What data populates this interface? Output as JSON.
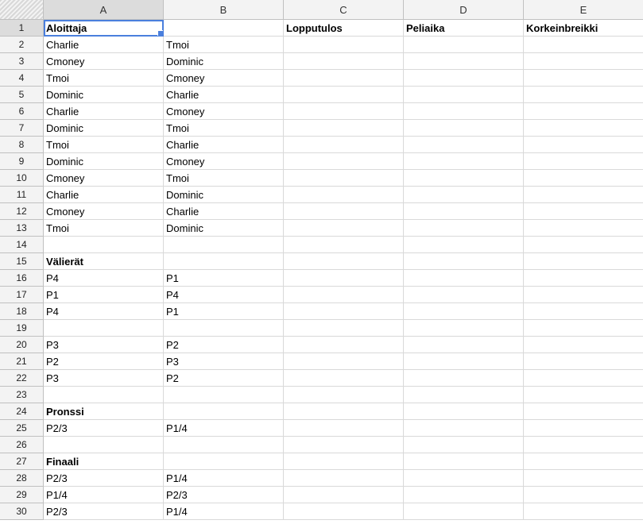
{
  "columns": [
    "A",
    "B",
    "C",
    "D",
    "E"
  ],
  "selected_column": "A",
  "active_cell": "A1",
  "rows": [
    {
      "n": "1",
      "A": "Aloittaja",
      "B": "",
      "C": "Lopputulos",
      "D": "Peliaika",
      "E": "Korkeinbreikki",
      "bold": true
    },
    {
      "n": "2",
      "A": "Charlie",
      "B": "Tmoi",
      "C": "",
      "D": "",
      "E": ""
    },
    {
      "n": "3",
      "A": "Cmoney",
      "B": "Dominic",
      "C": "",
      "D": "",
      "E": ""
    },
    {
      "n": "4",
      "A": "Tmoi",
      "B": "Cmoney",
      "C": "",
      "D": "",
      "E": ""
    },
    {
      "n": "5",
      "A": "Dominic",
      "B": "Charlie",
      "C": "",
      "D": "",
      "E": ""
    },
    {
      "n": "6",
      "A": "Charlie",
      "B": "Cmoney",
      "C": "",
      "D": "",
      "E": ""
    },
    {
      "n": "7",
      "A": "Dominic",
      "B": "Tmoi",
      "C": "",
      "D": "",
      "E": ""
    },
    {
      "n": "8",
      "A": "Tmoi",
      "B": "Charlie",
      "C": "",
      "D": "",
      "E": ""
    },
    {
      "n": "9",
      "A": "Dominic",
      "B": "Cmoney",
      "C": "",
      "D": "",
      "E": ""
    },
    {
      "n": "10",
      "A": "Cmoney",
      "B": "Tmoi",
      "C": "",
      "D": "",
      "E": ""
    },
    {
      "n": "11",
      "A": "Charlie",
      "B": "Dominic",
      "C": "",
      "D": "",
      "E": ""
    },
    {
      "n": "12",
      "A": "Cmoney",
      "B": "Charlie",
      "C": "",
      "D": "",
      "E": ""
    },
    {
      "n": "13",
      "A": "Tmoi",
      "B": "Dominic",
      "C": "",
      "D": "",
      "E": ""
    },
    {
      "n": "14",
      "A": "",
      "B": "",
      "C": "",
      "D": "",
      "E": ""
    },
    {
      "n": "15",
      "A": "Välierät",
      "B": "",
      "C": "",
      "D": "",
      "E": "",
      "bold": true
    },
    {
      "n": "16",
      "A": "P4",
      "B": "P1",
      "C": "",
      "D": "",
      "E": ""
    },
    {
      "n": "17",
      "A": "P1",
      "B": "P4",
      "C": "",
      "D": "",
      "E": ""
    },
    {
      "n": "18",
      "A": "P4",
      "B": "P1",
      "C": "",
      "D": "",
      "E": ""
    },
    {
      "n": "19",
      "A": "",
      "B": "",
      "C": "",
      "D": "",
      "E": ""
    },
    {
      "n": "20",
      "A": "P3",
      "B": "P2",
      "C": "",
      "D": "",
      "E": ""
    },
    {
      "n": "21",
      "A": "P2",
      "B": "P3",
      "C": "",
      "D": "",
      "E": ""
    },
    {
      "n": "22",
      "A": "P3",
      "B": "P2",
      "C": "",
      "D": "",
      "E": ""
    },
    {
      "n": "23",
      "A": "",
      "B": "",
      "C": "",
      "D": "",
      "E": ""
    },
    {
      "n": "24",
      "A": "Pronssi",
      "B": "",
      "C": "",
      "D": "",
      "E": "",
      "bold": true
    },
    {
      "n": "25",
      "A": "P2/3",
      "B": "P1/4",
      "C": "",
      "D": "",
      "E": ""
    },
    {
      "n": "26",
      "A": "",
      "B": "",
      "C": "",
      "D": "",
      "E": ""
    },
    {
      "n": "27",
      "A": "Finaali",
      "B": "",
      "C": "",
      "D": "",
      "E": "",
      "bold": true
    },
    {
      "n": "28",
      "A": "P2/3",
      "B": "P1/4",
      "C": "",
      "D": "",
      "E": ""
    },
    {
      "n": "29",
      "A": "P1/4",
      "B": "P2/3",
      "C": "",
      "D": "",
      "E": ""
    },
    {
      "n": "30",
      "A": "P2/3",
      "B": "P1/4",
      "C": "",
      "D": "",
      "E": ""
    }
  ]
}
